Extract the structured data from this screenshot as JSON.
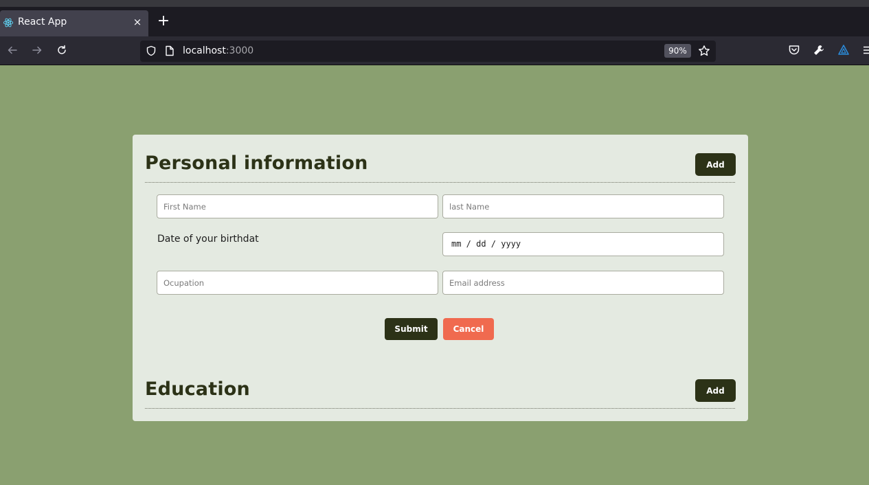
{
  "browser": {
    "tab": {
      "title": "React App",
      "favicon": "react-icon",
      "close_label": "×"
    },
    "new_tab_label": "+",
    "url": {
      "host": "localhost",
      "port": ":3000"
    },
    "zoom": "90%",
    "icons": [
      "back-arrow-icon",
      "forward-arrow-icon",
      "reload-icon",
      "shield-icon",
      "page-icon",
      "star-icon",
      "pocket-icon",
      "wrench-icon",
      "extension-icon",
      "menu-icon"
    ]
  },
  "colors": {
    "page_background": "#8aa070",
    "card_background": "#e4eae1",
    "primary_button": "#2c3217",
    "cancel_button": "#f06a4f"
  },
  "personal": {
    "title": "Personal information",
    "add_label": "Add",
    "first_name_placeholder": "First Name",
    "last_name_placeholder": "last Name",
    "birth_label": "Date of your birthdat",
    "date_placeholder": "mm / dd / yyyy",
    "occupation_placeholder": "Ocupation",
    "email_placeholder": "Email address",
    "submit_label": "Submit",
    "cancel_label": "Cancel"
  },
  "education": {
    "title": "Education",
    "add_label": "Add"
  }
}
